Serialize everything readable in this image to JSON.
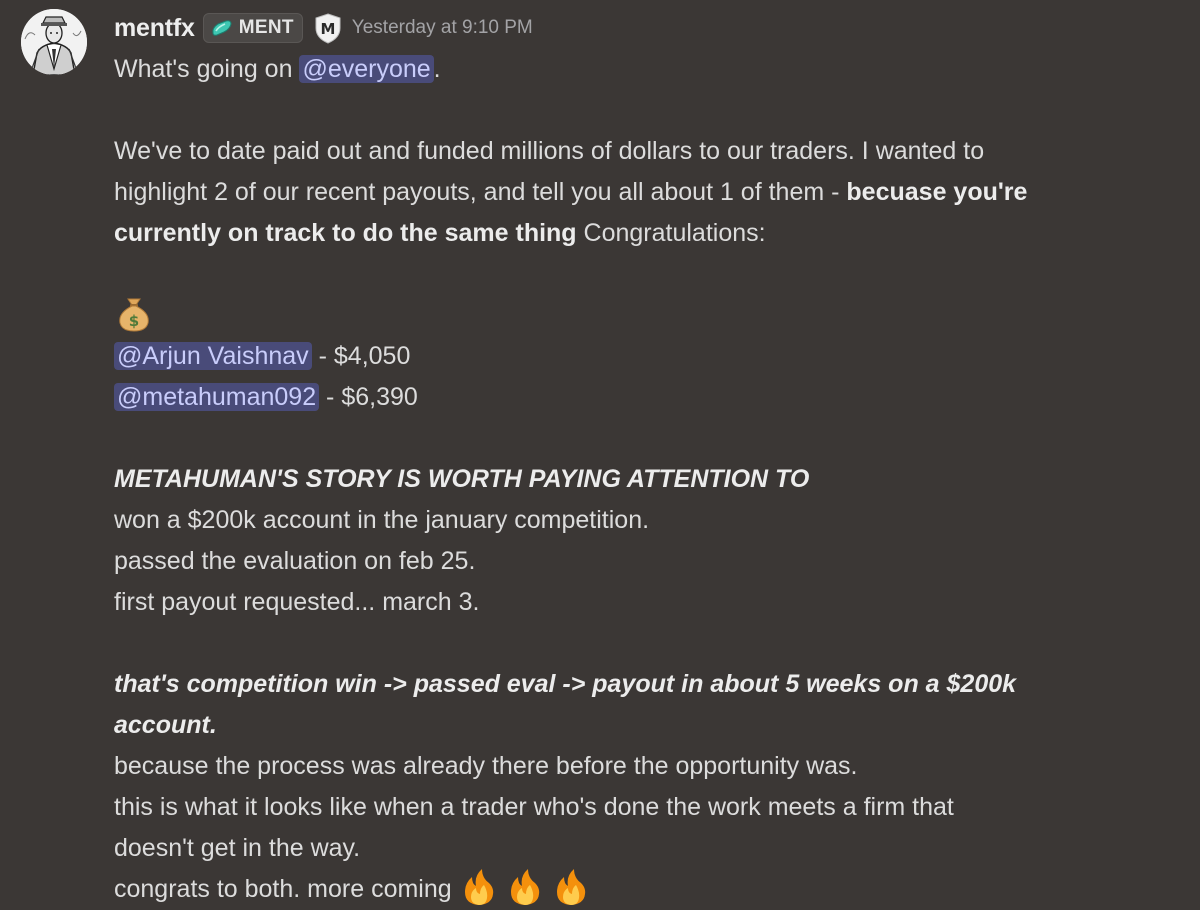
{
  "message": {
    "author": {
      "username": "mentfx",
      "guild_tag": "MENT",
      "role_badge_letter": "M",
      "avatar": "avatar-illustration"
    },
    "timestamp": "Yesterday at 9:10 PM",
    "colors": {
      "background": "#3b3735",
      "mention_bg": "#494b79",
      "mention_text": "#c9cdfb",
      "tag_gem": "#3ec7b2"
    },
    "lines": {
      "l1_prefix": "What's going on ",
      "l1_mention": "@everyone",
      "l1_suffix": ".",
      "l3": "We've to date paid out and funded millions of dollars to our traders. I wanted to",
      "l4_prefix": "highlight 2 of our recent payouts, and tell you all about 1 of them - ",
      "l4_bold": "becuase you're",
      "l5_bold": "currently on track to do the same thing",
      "l5_suffix": " Congratulations:",
      "l7_emoji": "money-bag-emoji",
      "l8_mention": "@Arjun Vaishnav",
      "l8_suffix": " - $4,050",
      "l9_mention": "@metahuman092",
      "l9_suffix": " - $6,390",
      "l11_bold_italic": "METAHUMAN'S STORY IS WORTH PAYING ATTENTION TO",
      "l12": "won a $200k account in the january competition.",
      "l13": "passed the evaluation on feb 25.",
      "l14": "first payout requested... march 3.",
      "l16_bold_italic": "that's competition win -> passed eval -> payout in about 5 weeks on a $200k",
      "l17_bold_italic": "account.",
      "l18": "because the process was already there before the opportunity was.",
      "l19": "this is what it looks like when a trader who's done the work meets a firm that",
      "l20": "doesn't get in the way.",
      "l21": "congrats to both. more coming ",
      "l21_emojis": [
        "fire-emoji",
        "fire-emoji",
        "fire-emoji"
      ]
    }
  }
}
